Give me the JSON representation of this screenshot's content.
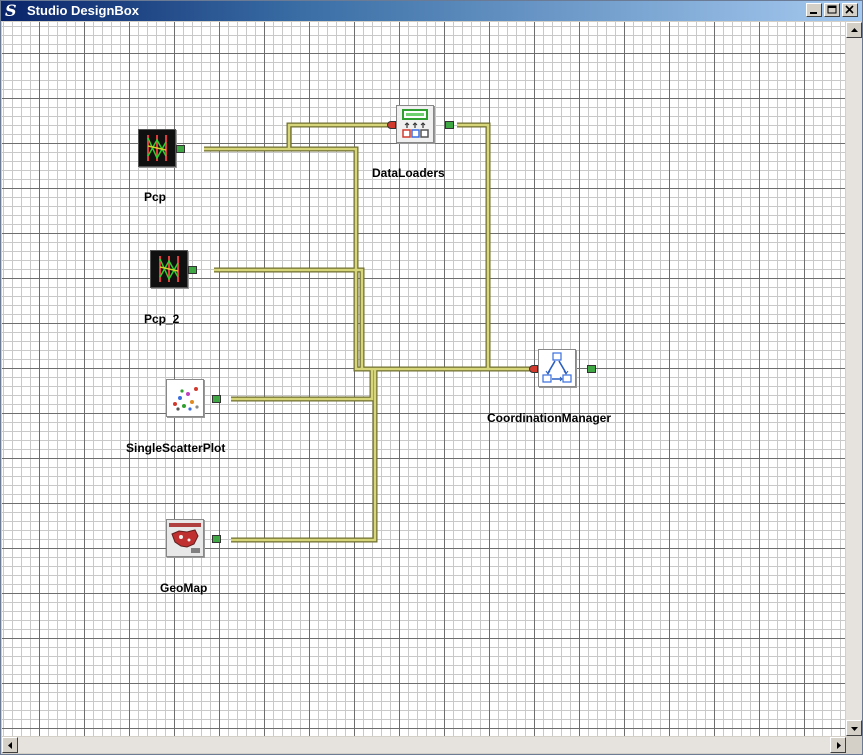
{
  "window": {
    "title": "Studio DesignBox",
    "title_icon": "studio-s-icon",
    "buttons": [
      "minimize",
      "maximize",
      "close"
    ]
  },
  "components": {
    "pcp": {
      "label": "Pcp",
      "icon": "parallel-coordinates-icon"
    },
    "pcp_2": {
      "label": "Pcp_2",
      "icon": "parallel-coordinates-icon"
    },
    "scatter": {
      "label": "SingleScatterPlot",
      "icon": "scatter-plot-icon"
    },
    "geomap": {
      "label": "GeoMap",
      "icon": "geo-map-icon"
    },
    "dataloaders": {
      "label": "DataLoaders",
      "icon": "data-loader-icon"
    },
    "coordination": {
      "label": "CoordinationManager",
      "icon": "coordination-cycle-icon"
    }
  },
  "colors": {
    "wire": "#c8c86a",
    "wire_edge": "#6f6f30",
    "port_out": "#3fa845",
    "port_in": "#d23a2e",
    "grid_major": "#6e6e6e",
    "grid_minor": "#c9c9c9",
    "title_start": "#0a246a",
    "title_end": "#a6caf0"
  }
}
